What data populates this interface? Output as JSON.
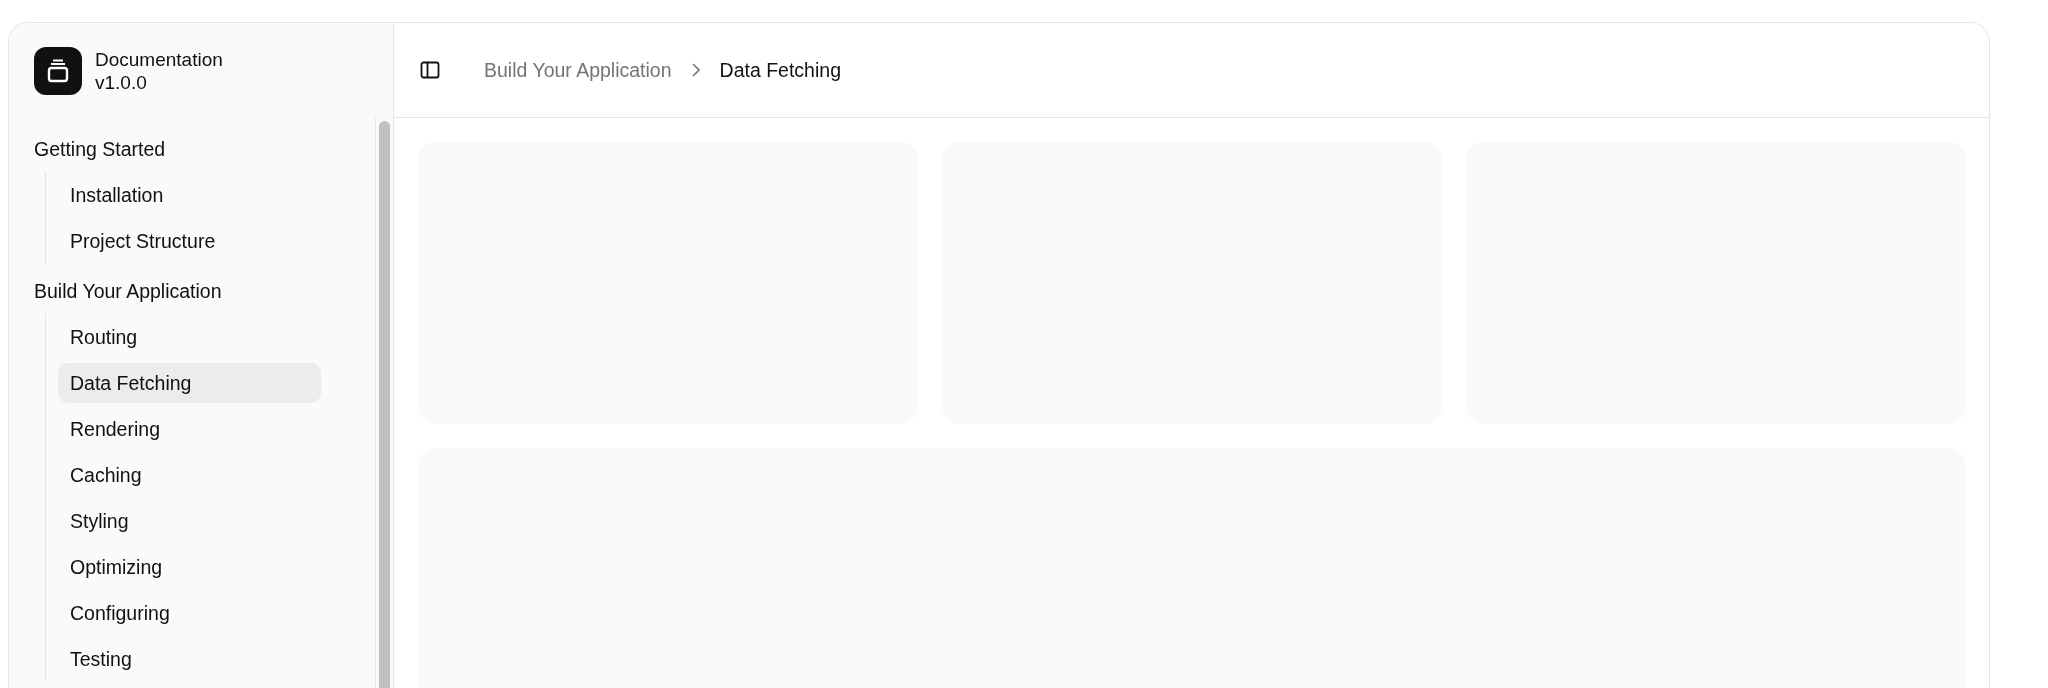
{
  "sidebar": {
    "brand": {
      "title": "Documentation",
      "version": "v1.0.0"
    },
    "groups": [
      {
        "label": "Getting Started",
        "items": [
          {
            "label": "Installation",
            "selected": false
          },
          {
            "label": "Project Structure",
            "selected": false
          }
        ]
      },
      {
        "label": "Build Your Application",
        "items": [
          {
            "label": "Routing",
            "selected": false
          },
          {
            "label": "Data Fetching",
            "selected": true
          },
          {
            "label": "Rendering",
            "selected": false
          },
          {
            "label": "Caching",
            "selected": false
          },
          {
            "label": "Styling",
            "selected": false
          },
          {
            "label": "Optimizing",
            "selected": false
          },
          {
            "label": "Configuring",
            "selected": false
          },
          {
            "label": "Testing",
            "selected": false
          }
        ]
      }
    ]
  },
  "header": {
    "breadcrumb": [
      {
        "label": "Build Your Application",
        "current": false
      },
      {
        "label": "Data Fetching",
        "current": true
      }
    ]
  }
}
